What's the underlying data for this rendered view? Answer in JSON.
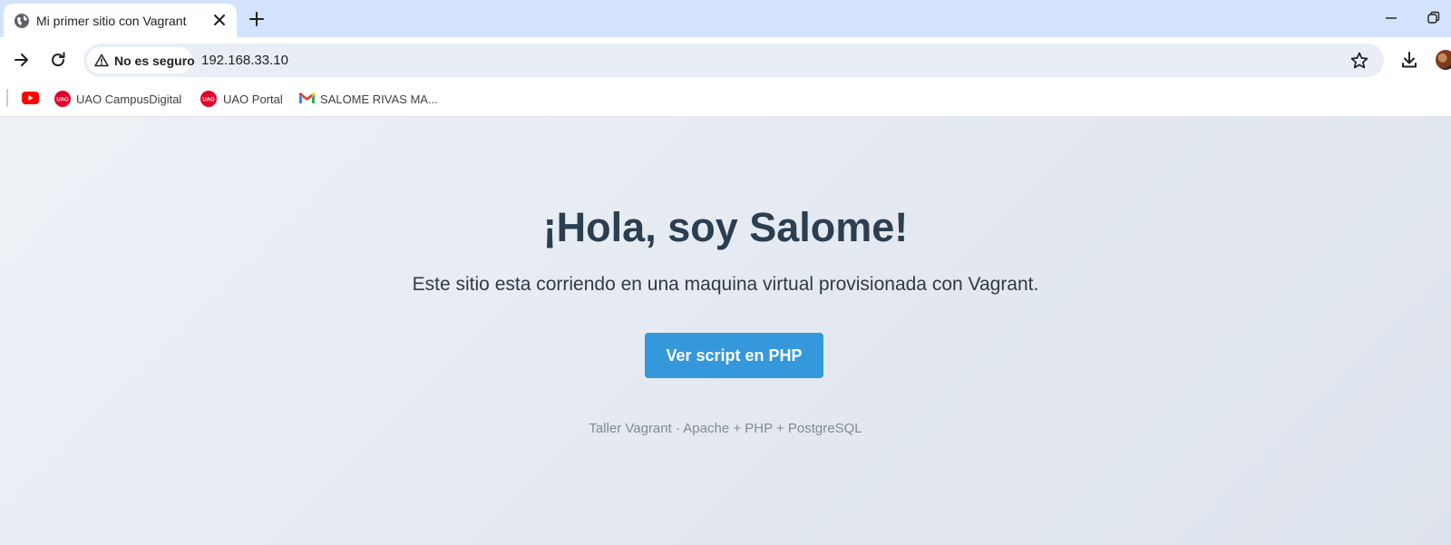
{
  "browser": {
    "tab": {
      "title": "Mi primer sitio con Vagrant",
      "favicon": "globe-icon"
    },
    "omnibox": {
      "security_label": "No es seguro",
      "url": "192.168.33.10"
    },
    "bookmarks": [
      {
        "label": "",
        "icon": "youtube-icon"
      },
      {
        "label": "UAO  CampusDigital",
        "icon": "uao-icon"
      },
      {
        "label": "UAO Portal",
        "icon": "uao-icon"
      },
      {
        "label": "SALOME RIVAS MA...",
        "icon": "gmail-icon"
      }
    ],
    "colors": {
      "tabstrip": "#d3e3fd",
      "omnibox": "#e9eef6"
    }
  },
  "page": {
    "title": "¡Hola, soy Salome!",
    "subtitle": "Este sitio esta corriendo en una maquina virtual provisionada con Vagrant.",
    "button_label": "Ver script en PHP",
    "footer": "Taller Vagrant · Apache + PHP + PostgreSQL",
    "colors": {
      "title": "#2c3e50",
      "button": "#3498db",
      "footer": "#7f8c8d"
    }
  }
}
